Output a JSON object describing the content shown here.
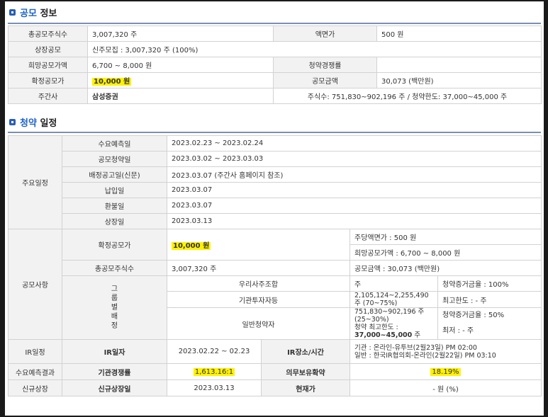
{
  "section1": {
    "title_prefix": "공모",
    "title_suffix": "정보"
  },
  "info": {
    "total_shares_label": "총공모주식수",
    "total_shares": "3,007,320 주",
    "par_label": "액면가",
    "par": "500 원",
    "listing_label": "상장공모",
    "listing": "신주모집 : 3,007,320 주 (100%)",
    "hope_label": "희망공모가액",
    "hope": "6,700 ~ 8,000 원",
    "comp_label": "청약경쟁률",
    "comp": "",
    "fixed_label": "확정공모가",
    "fixed": "10,000 원",
    "amount_label": "공모금액",
    "amount": "30,073 (백만원)",
    "underwriter_label": "주간사",
    "underwriter": "삼성증권",
    "underwriter_detail": "주식수: 751,830~902,196 주    /    청약한도: 37,000~45,000 주"
  },
  "section2": {
    "title_prefix": "청약",
    "title_suffix": "일정"
  },
  "schedule": {
    "group_label": "주요일정",
    "rows": [
      {
        "label": "수요예측일",
        "value": "2023.02.23   ~    2023.02.24"
      },
      {
        "label": "공모청약일",
        "value": "2023.03.02   ~    2023.03.03"
      },
      {
        "label": "배정공고일(신문)",
        "value": "2023.03.07 (주간사 홈페이지 참조)"
      },
      {
        "label": "납입일",
        "value": "2023.03.07"
      },
      {
        "label": "환불일",
        "value": "2023.03.07"
      },
      {
        "label": "상장일",
        "value": "2023.03.13"
      }
    ]
  },
  "offer": {
    "group_label": "공모사항",
    "fixed_label": "확정공모가",
    "fixed": "10,000 원",
    "par_text": "주당액면가 :  500 원",
    "hope_text": "희망공모가액 :  6,700 ~ 8,000 원",
    "total_label": "총공모주식수",
    "total": "3,007,320 주",
    "amount_text": "공모금액 : 30,073 (백만원)",
    "alloc_label": "그룹별배정",
    "alloc": [
      {
        "name": "우리사주조합",
        "shares": "주",
        "note": "청약증거금율 : 100%"
      },
      {
        "name": "기관투자자등",
        "shares": "2,105,124~2,255,490 주 (70~75%)",
        "note": "최고한도 :  - 주"
      },
      {
        "name": "일반청약자",
        "shares": "751,830~902,196 주 (25~30%)",
        "note": "청약증거금율 : 50%"
      }
    ],
    "general_limit_label": "청약 최고한도 :",
    "general_limit": "37,000~45,000",
    "general_limit_unit": "주",
    "general_min": "최저 :  - 주"
  },
  "ir": {
    "label": "IR일정",
    "date_label": "IR일자",
    "date": "2023.02.22 ~ 02.23",
    "place_label": "IR장소/시간",
    "place1": "기관 : 온라인-유투브(2월23일) PM 02:00",
    "place2": "일반 : 한국IR협의회-온라인(2월22일) PM 03:10"
  },
  "demand": {
    "label": "수요예측결과",
    "comp_label": "기관경쟁률",
    "comp": "1,613.16:1",
    "lockup_label": "의무보유확약",
    "lockup": "18.19%"
  },
  "newlist": {
    "label": "신규상장",
    "date_label": "신규상장일",
    "date": "2023.03.13",
    "price_label": "현재가",
    "price": "- 원 (%)"
  }
}
